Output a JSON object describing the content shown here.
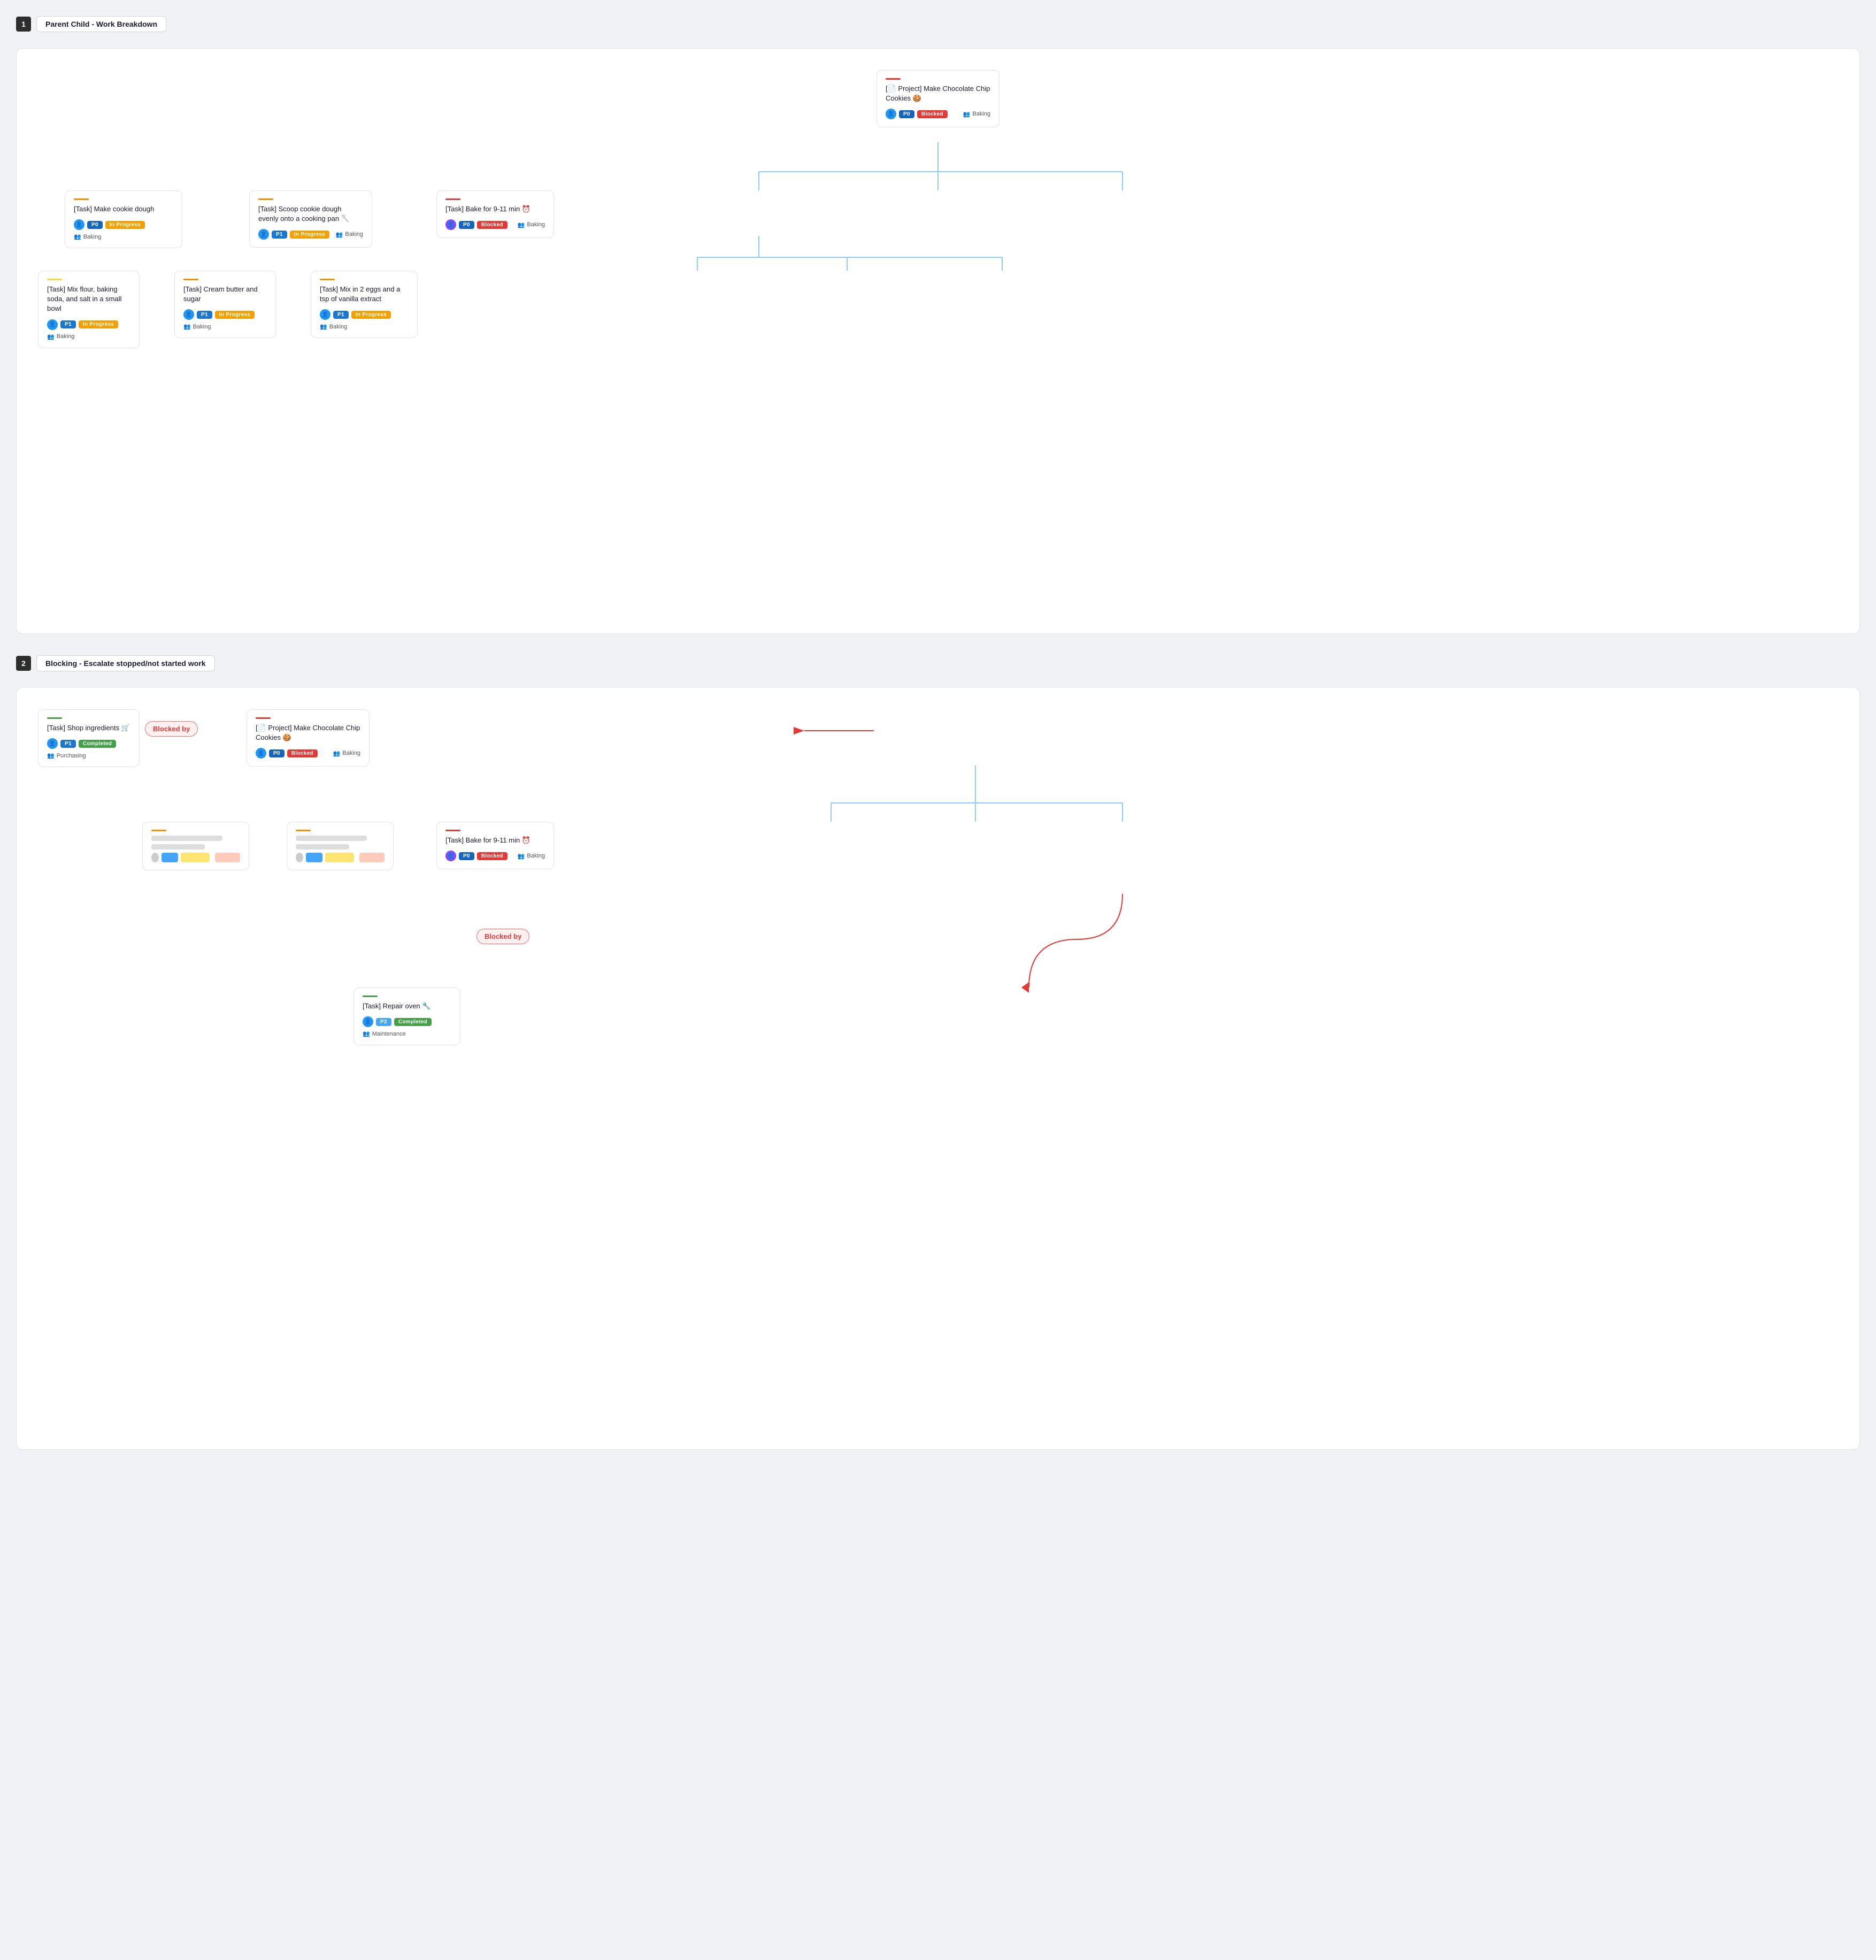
{
  "section1": {
    "num": "1",
    "title": "Parent Child - Work Breakdown",
    "root": {
      "accent": "accent-red",
      "title": "[📄 Project] Make Chocolate Chip Cookies 🍪",
      "priority": "P0",
      "priorityClass": "badge-p0",
      "status": "Blocked",
      "statusClass": "badge-blocked",
      "team": "Baking",
      "avatarColor": "avatar-blue"
    },
    "level1": [
      {
        "accent": "accent-orange",
        "title": "[Task] Make cookie dough",
        "priority": "P0",
        "priorityClass": "badge-p0",
        "status": "In Progress",
        "statusClass": "badge-in-progress",
        "team": "Baking",
        "avatarColor": "avatar-blue",
        "hasChildren": true
      },
      {
        "accent": "accent-orange",
        "title": "[Task] Scoop cookie dough evenly onto a cooking pan 🥄",
        "priority": "P1",
        "priorityClass": "badge-p1",
        "status": "In Progress",
        "statusClass": "badge-in-progress",
        "team": "Baking",
        "avatarColor": "avatar-blue",
        "hasChildren": false
      },
      {
        "accent": "accent-red",
        "title": "[Task] Bake for 9-11 min ⏰",
        "priority": "P0",
        "priorityClass": "badge-p0",
        "status": "Blocked",
        "statusClass": "badge-blocked",
        "team": "Baking",
        "avatarColor": "avatar-purple",
        "hasChildren": false
      }
    ],
    "level2": [
      {
        "accent": "accent-yellow",
        "title": "[Task] Mix flour, baking soda, and salt in a small bowl",
        "priority": "P1",
        "priorityClass": "badge-p1",
        "status": "In Progress",
        "statusClass": "badge-in-progress",
        "team": "Baking",
        "avatarColor": "avatar-blue"
      },
      {
        "accent": "accent-orange",
        "title": "[Task] Cream butter and sugar",
        "priority": "P1",
        "priorityClass": "badge-p1",
        "status": "In Progress",
        "statusClass": "badge-in-progress",
        "team": "Baking",
        "avatarColor": "avatar-blue"
      },
      {
        "accent": "accent-orange",
        "title": "[Task] Mix in 2 eggs and a tsp of vanilla extract",
        "priority": "P1",
        "priorityClass": "badge-p1",
        "status": "In Progress",
        "statusClass": "badge-in-progress",
        "team": "Baking",
        "avatarColor": "avatar-blue"
      }
    ]
  },
  "section2": {
    "num": "2",
    "title": "Blocking - Escalate stopped/not started work",
    "shop_card": {
      "accent": "accent-green",
      "title": "[Task] Shop ingredients 🛒",
      "priority": "P1",
      "priorityClass": "badge-p1",
      "status": "Completed",
      "statusClass": "badge-completed",
      "team": "Purchasing",
      "avatarColor": "avatar-blue"
    },
    "blocked_by_label1": "Blocked by",
    "project_card": {
      "accent": "accent-red",
      "title": "[📄 Project] Make Chocolate Chip Cookies 🍪",
      "priority": "P0",
      "priorityClass": "badge-p0",
      "status": "Blocked",
      "statusClass": "badge-blocked",
      "team": "Baking",
      "avatarColor": "avatar-blue"
    },
    "bake_card": {
      "accent": "accent-red",
      "title": "[Task] Bake for 9-11 min ⏰",
      "priority": "P0",
      "priorityClass": "badge-p0",
      "status": "Blocked",
      "statusClass": "badge-blocked",
      "team": "Baking",
      "avatarColor": "avatar-purple"
    },
    "blocked_by_label2": "Blocked by",
    "repair_card": {
      "accent": "accent-green",
      "title": "[Task] Repair oven 🔧",
      "priority": "P2",
      "priorityClass": "badge-p2",
      "status": "Completed",
      "statusClass": "badge-completed",
      "team": "Maintenance",
      "avatarColor": "avatar-blue"
    }
  }
}
